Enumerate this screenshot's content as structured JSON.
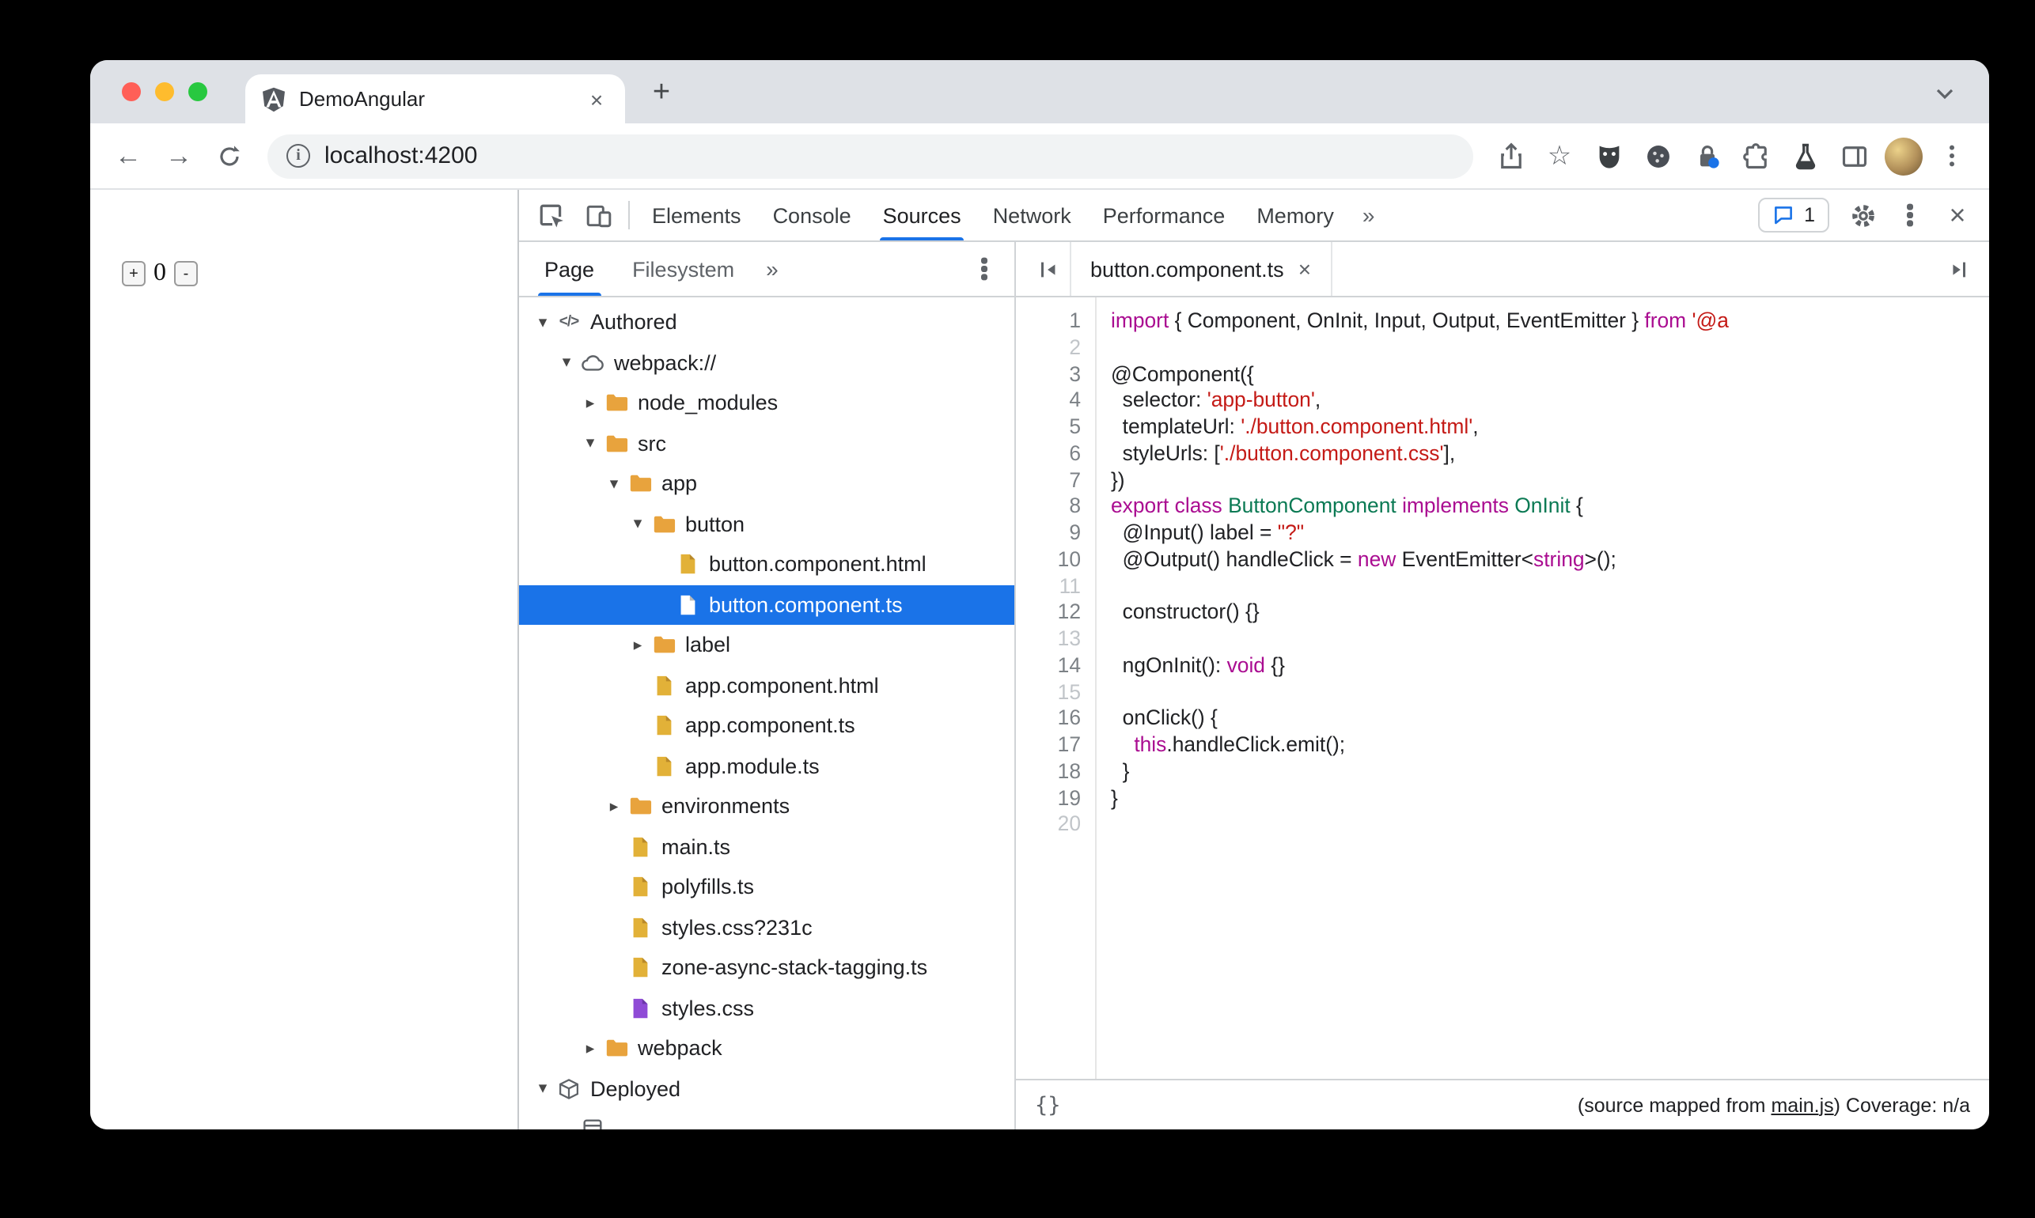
{
  "colors": {
    "accent_blue": "#1a73e8",
    "selection_blue": "#1a73e8",
    "folder_orange": "#e8a33d",
    "file_yellow": "#e2b138",
    "file_purple": "#8f4bd6",
    "token_keyword": "#aa0d91",
    "token_string": "#c41a16",
    "token_type": "#0b7a54",
    "traffic_red": "#ff5f57",
    "traffic_yellow": "#febc2e",
    "traffic_green": "#28c840"
  },
  "glyphs": {
    "new_tab": "+",
    "tab_close": "×",
    "back": "←",
    "forward": "→",
    "star": "☆",
    "more_tabs": "»",
    "devtools_close": "×",
    "editor_tab_close": "×",
    "expand_open": "▾",
    "expand_closed": "▸",
    "format_braces": "{}"
  },
  "browser": {
    "tab_title": "DemoAngular",
    "url": "localhost:4200"
  },
  "page": {
    "counter_plus": "+",
    "counter_value": "0",
    "counter_minus": "-"
  },
  "devtools": {
    "main_tabs": [
      "Elements",
      "Console",
      "Sources",
      "Network",
      "Performance",
      "Memory"
    ],
    "selected_main_tab": "Sources",
    "messages_count": "1",
    "sidebar": {
      "tabs": [
        "Page",
        "Filesystem"
      ],
      "selected_tab": "Page",
      "tree": [
        {
          "label": "Authored",
          "icon": "code",
          "depth": 0,
          "state": "open"
        },
        {
          "label": "webpack://",
          "icon": "cloud",
          "depth": 1,
          "state": "open"
        },
        {
          "label": "node_modules",
          "icon": "folder",
          "depth": 2,
          "state": "closed"
        },
        {
          "label": "src",
          "icon": "folder",
          "depth": 2,
          "state": "open"
        },
        {
          "label": "app",
          "icon": "folder",
          "depth": 3,
          "state": "open"
        },
        {
          "label": "button",
          "icon": "folder",
          "depth": 4,
          "state": "open"
        },
        {
          "label": "button.component.html",
          "icon": "file",
          "color": "yellow",
          "depth": 5
        },
        {
          "label": "button.component.ts",
          "icon": "file",
          "color": "white",
          "depth": 5,
          "selected": true
        },
        {
          "label": "label",
          "icon": "folder",
          "depth": 4,
          "state": "closed"
        },
        {
          "label": "app.component.html",
          "icon": "file",
          "color": "yellow",
          "depth": 4
        },
        {
          "label": "app.component.ts",
          "icon": "file",
          "color": "yellow",
          "depth": 4
        },
        {
          "label": "app.module.ts",
          "icon": "file",
          "color": "yellow",
          "depth": 4
        },
        {
          "label": "environments",
          "icon": "folder",
          "depth": 3,
          "state": "closed"
        },
        {
          "label": "main.ts",
          "icon": "file",
          "color": "yellow",
          "depth": 3
        },
        {
          "label": "polyfills.ts",
          "icon": "file",
          "color": "yellow",
          "depth": 3
        },
        {
          "label": "styles.css?231c",
          "icon": "file",
          "color": "yellow",
          "depth": 3
        },
        {
          "label": "zone-async-stack-tagging.ts",
          "icon": "file",
          "color": "yellow",
          "depth": 3
        },
        {
          "label": "styles.css",
          "icon": "file",
          "color": "purple",
          "depth": 3
        },
        {
          "label": "webpack",
          "icon": "folder",
          "depth": 2,
          "state": "closed"
        },
        {
          "label": "Deployed",
          "icon": "cube",
          "depth": 0,
          "state": "open"
        },
        {
          "label": "",
          "icon": "frame",
          "depth": 1
        }
      ]
    },
    "editor": {
      "file_tab": "button.component.ts",
      "lines": [
        {
          "n": 1,
          "tokens": [
            [
              "kw",
              "import"
            ],
            [
              "pl",
              " { Component, OnInit, Input, Output, EventEmitter } "
            ],
            [
              "kw",
              "from"
            ],
            [
              "pl",
              " "
            ],
            [
              "str",
              "'@a"
            ]
          ]
        },
        {
          "n": 2,
          "tokens": []
        },
        {
          "n": 3,
          "tokens": [
            [
              "pl",
              "@Component({"
            ]
          ]
        },
        {
          "n": 4,
          "tokens": [
            [
              "pl",
              "  selector: "
            ],
            [
              "str",
              "'app-button'"
            ],
            [
              "pl",
              ","
            ]
          ]
        },
        {
          "n": 5,
          "tokens": [
            [
              "pl",
              "  templateUrl: "
            ],
            [
              "str",
              "'./button.component.html'"
            ],
            [
              "pl",
              ","
            ]
          ]
        },
        {
          "n": 6,
          "tokens": [
            [
              "pl",
              "  styleUrls: ["
            ],
            [
              "str",
              "'./button.component.css'"
            ],
            [
              "pl",
              "],"
            ]
          ]
        },
        {
          "n": 7,
          "tokens": [
            [
              "pl",
              "})"
            ]
          ]
        },
        {
          "n": 8,
          "tokens": [
            [
              "kw",
              "export"
            ],
            [
              "pl",
              " "
            ],
            [
              "kw",
              "class"
            ],
            [
              "pl",
              " "
            ],
            [
              "typ",
              "ButtonComponent"
            ],
            [
              "pl",
              " "
            ],
            [
              "kw",
              "implements"
            ],
            [
              "pl",
              " "
            ],
            [
              "typ",
              "OnInit"
            ],
            [
              "pl",
              " {"
            ]
          ]
        },
        {
          "n": 9,
          "tokens": [
            [
              "pl",
              "  @Input() label = "
            ],
            [
              "str",
              "\"?\""
            ]
          ]
        },
        {
          "n": 10,
          "tokens": [
            [
              "pl",
              "  @Output() handleClick = "
            ],
            [
              "kw",
              "new"
            ],
            [
              "pl",
              " EventEmitter<"
            ],
            [
              "kw",
              "string"
            ],
            [
              "pl",
              ">();"
            ]
          ]
        },
        {
          "n": 11,
          "tokens": []
        },
        {
          "n": 12,
          "tokens": [
            [
              "pl",
              "  constructor() {}"
            ]
          ]
        },
        {
          "n": 13,
          "tokens": []
        },
        {
          "n": 14,
          "tokens": [
            [
              "pl",
              "  ngOnInit(): "
            ],
            [
              "kw",
              "void"
            ],
            [
              "pl",
              " {}"
            ]
          ]
        },
        {
          "n": 15,
          "tokens": []
        },
        {
          "n": 16,
          "tokens": [
            [
              "pl",
              "  onClick() {"
            ]
          ]
        },
        {
          "n": 17,
          "tokens": [
            [
              "pl",
              "    "
            ],
            [
              "kw",
              "this"
            ],
            [
              "pl",
              ".handleClick.emit();"
            ]
          ]
        },
        {
          "n": 18,
          "tokens": [
            [
              "pl",
              "  }"
            ]
          ]
        },
        {
          "n": 19,
          "tokens": [
            [
              "pl",
              "}"
            ]
          ]
        },
        {
          "n": 20,
          "tokens": []
        }
      ],
      "status_prefix": "(source mapped from ",
      "status_link": "main.js",
      "status_suffix": ") Coverage: n/a"
    }
  }
}
